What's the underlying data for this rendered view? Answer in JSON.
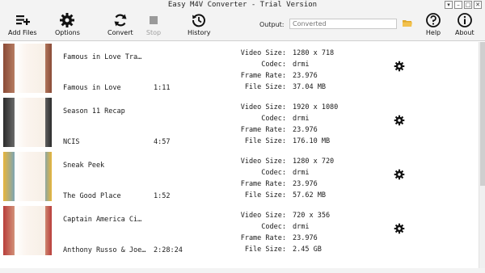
{
  "window": {
    "title": "Easy M4V Converter - Trial Version",
    "minimize": "▾",
    "restore": "–",
    "maximize": "□",
    "close": "✕"
  },
  "toolbar": {
    "add_files": "Add Files",
    "options": "Options",
    "convert": "Convert",
    "stop": "Stop",
    "history": "History",
    "help": "Help",
    "about": "About"
  },
  "output": {
    "label": "Output:",
    "placeholder": "Converted"
  },
  "labels": {
    "video_size": "Video Size:",
    "codec": "Codec:",
    "frame_rate": "Frame Rate:",
    "file_size": "File Size:"
  },
  "items": [
    {
      "title": "Famous in Love  Tra…",
      "name": "Famous in Love",
      "duration": "1:11",
      "video_size": "1280 x 718",
      "codec": "drmi",
      "frame_rate": "23.976",
      "file_size": "37.04 MB",
      "thumb_colors": [
        "#8a4a36",
        "#c28a6e"
      ]
    },
    {
      "title": "Season 11 Recap",
      "name": "NCIS",
      "duration": "4:57",
      "video_size": "1920 x 1080",
      "codec": "drmi",
      "frame_rate": "23.976",
      "file_size": "176.10 MB",
      "thumb_colors": [
        "#2b2b2b",
        "#7b7b7b"
      ]
    },
    {
      "title": "Sneak Peek",
      "name": "The Good Place",
      "duration": "1:52",
      "video_size": "1280 x 720",
      "codec": "drmi",
      "frame_rate": "23.976",
      "file_size": "57.62 MB",
      "thumb_colors": [
        "#e8b53a",
        "#5fa0d6"
      ]
    },
    {
      "title": "Captain America  Ci…",
      "name": "Anthony Russo & Joe…",
      "duration": "2:28:24",
      "video_size": "720 x 356",
      "codec": "drmi",
      "frame_rate": "23.976",
      "file_size": "2.45 GB",
      "thumb_colors": [
        "#b83d3a",
        "#d9a98a"
      ]
    }
  ]
}
